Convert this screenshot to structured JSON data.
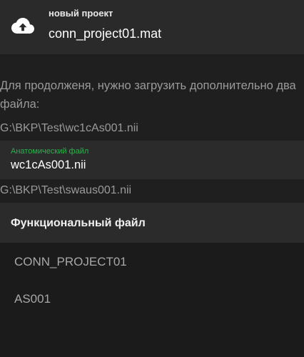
{
  "header": {
    "caption": "новый проект",
    "project_name": "conn_project01.mat",
    "icon": "cloud-upload-icon"
  },
  "message": {
    "text": "Для продолженя, нужно загрузить дополнительно два файла:"
  },
  "paths": {
    "anatomical": "G:\\BKP\\Test\\wc1cAs001.nii",
    "functional": "G:\\BKP\\Test\\swaus001.nii"
  },
  "anatomical": {
    "label": "Анатомический файл",
    "value": "wc1cAs001.nii",
    "label_color": "#2bb24c"
  },
  "functional": {
    "title": "Функциональный файл",
    "items": [
      {
        "label": "CONN_PROJECT01"
      },
      {
        "label": "AS001"
      }
    ]
  }
}
